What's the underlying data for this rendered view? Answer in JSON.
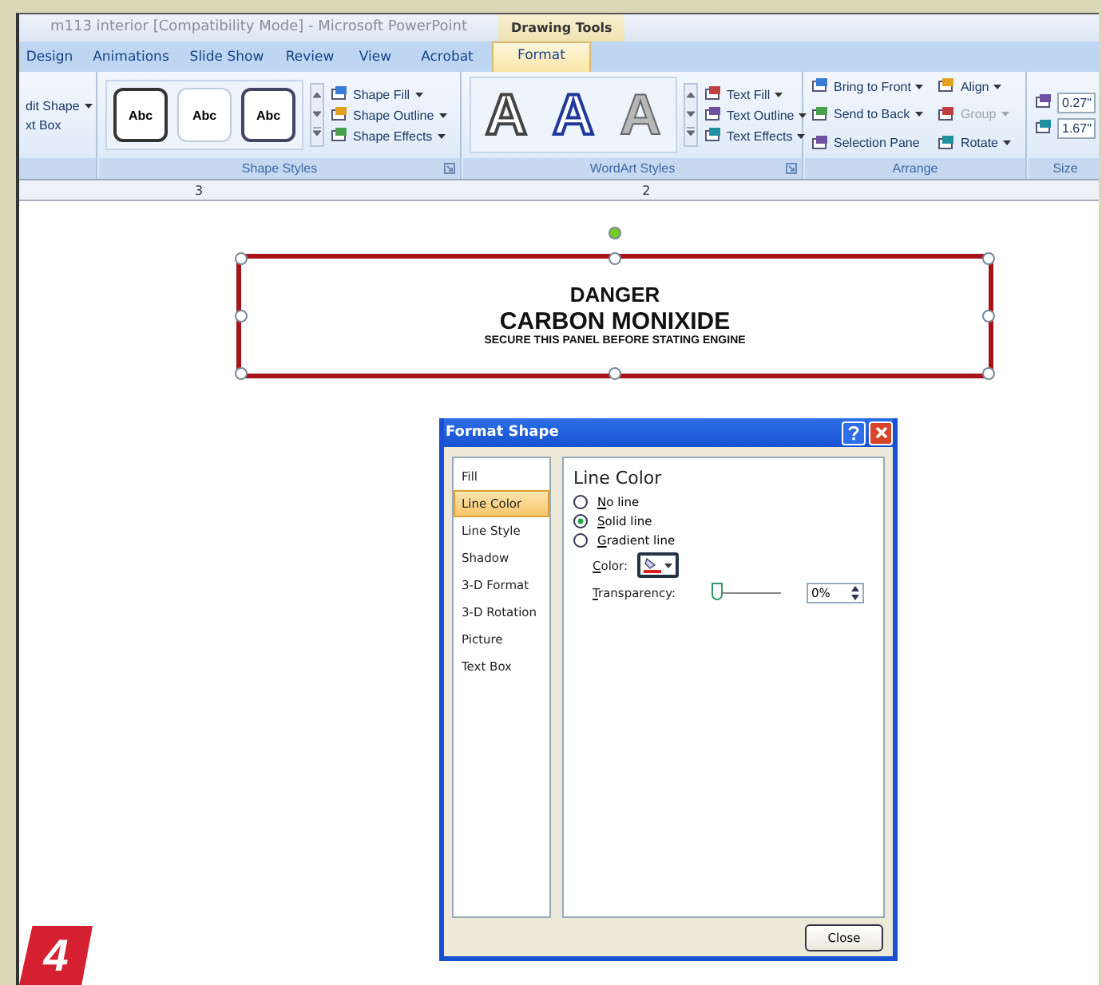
{
  "window": {
    "title": "m113 interior [Compatibility Mode] - Microsoft PowerPoint",
    "contextual_group": "Drawing Tools"
  },
  "tabs": [
    {
      "label": "Design",
      "selected": false
    },
    {
      "label": "Animations",
      "selected": false
    },
    {
      "label": "Slide Show",
      "selected": false
    },
    {
      "label": "Review",
      "selected": false
    },
    {
      "label": "View",
      "selected": false
    },
    {
      "label": "Acrobat",
      "selected": false
    },
    {
      "label": "Format",
      "selected": true
    }
  ],
  "ribbon": {
    "insert_shapes": {
      "commands": [
        {
          "label": "dit Shape",
          "dropdown": true
        },
        {
          "label": "xt Box",
          "dropdown": false
        }
      ]
    },
    "shape_styles": {
      "label": "Shape Styles",
      "swatches": [
        "Abc",
        "Abc",
        "Abc"
      ],
      "commands": [
        {
          "label": "Shape Fill",
          "dropdown": true
        },
        {
          "label": "Shape Outline",
          "dropdown": true
        },
        {
          "label": "Shape Effects",
          "dropdown": true
        }
      ]
    },
    "wordart_styles": {
      "label": "WordArt Styles",
      "letters": [
        "A",
        "A",
        "A"
      ],
      "commands": [
        {
          "label": "Text Fill",
          "dropdown": true
        },
        {
          "label": "Text Outline",
          "dropdown": true
        },
        {
          "label": "Text Effects",
          "dropdown": true
        }
      ]
    },
    "arrange": {
      "label": "Arrange",
      "commands": [
        {
          "label": "Bring to Front",
          "dropdown": true,
          "disabled": false
        },
        {
          "label": "Align",
          "dropdown": true,
          "disabled": false
        },
        {
          "label": "Send to Back",
          "dropdown": true,
          "disabled": false
        },
        {
          "label": "Group",
          "dropdown": true,
          "disabled": true
        },
        {
          "label": "Selection Pane",
          "dropdown": false,
          "disabled": false
        },
        {
          "label": "Rotate",
          "dropdown": true,
          "disabled": false
        }
      ]
    },
    "size": {
      "label": "Size",
      "values": [
        "0.27\"",
        "1.67\""
      ]
    }
  },
  "ruler": {
    "labels": [
      "3",
      "2"
    ]
  },
  "slide": {
    "shape": {
      "selected": true,
      "lines": [
        "DANGER",
        "CARBON MONIXIDE",
        "SECURE THIS PANEL BEFORE STATING ENGINE"
      ]
    }
  },
  "dialog": {
    "title": "Format Shape",
    "categories": [
      {
        "label": "Fill",
        "selected": false
      },
      {
        "label": "Line Color",
        "selected": true
      },
      {
        "label": "Line Style",
        "selected": false
      },
      {
        "label": "Shadow",
        "selected": false
      },
      {
        "label": "3-D Format",
        "selected": false
      },
      {
        "label": "3-D Rotation",
        "selected": false
      },
      {
        "label": "Picture",
        "selected": false
      },
      {
        "label": "Text Box",
        "selected": false
      }
    ],
    "heading": "Line Color",
    "options": [
      {
        "label": "No line",
        "selected": false
      },
      {
        "label": "Solid line",
        "selected": true
      },
      {
        "label": "Gradient line",
        "selected": false
      }
    ],
    "color": {
      "label": "Color:",
      "color": "#e02020"
    },
    "transparency": {
      "label": "Transparency:",
      "level": 0,
      "value": "0%"
    },
    "close": "Close"
  },
  "badge": "4"
}
